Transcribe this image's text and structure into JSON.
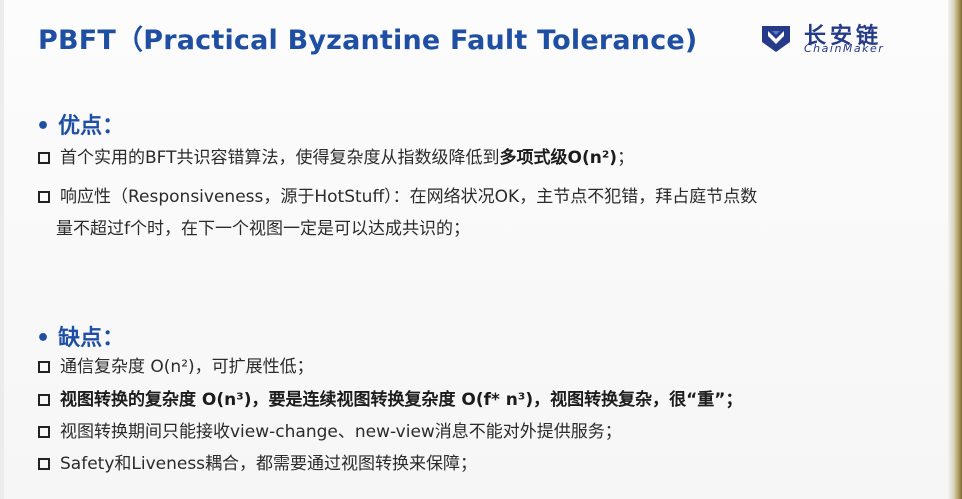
{
  "slide": {
    "title": "PBFT（Practical Byzantine Fault Tolerance)",
    "logo": {
      "cn": "长安链",
      "en": "ChainMaker",
      "icon": "chainmaker-logo-icon",
      "color": "#263a8a"
    },
    "accent_color": "#1f4fa3"
  },
  "pros": {
    "bullet": "•",
    "heading": "优点：",
    "items": [
      {
        "before": "首个实用的BFT共识容错算法，使得复杂度从指数级降低到",
        "bold": "多项式级O(n²)",
        "after": "；"
      },
      {
        "line1": "响应性（Responsiveness，源于HotStuff）：在网络状况OK，主节点不犯错，拜占庭节点数",
        "line2": "量不超过f个时，在下一个视图一定是可以达成共识的；"
      }
    ]
  },
  "cons": {
    "bullet": "•",
    "heading": "缺点：",
    "items": [
      "通信复杂度 O(n²)，可扩展性低；",
      "视图转换的复杂度 O(n³)，要是连续视图转换复杂度 O(f* n³)，视图转换复杂，很“重”；",
      "视图转换期间只能接收view-change、new-view消息不能对外提供服务；",
      "Safety和Liveness耦合，都需要通过视图转换来保障；"
    ]
  }
}
